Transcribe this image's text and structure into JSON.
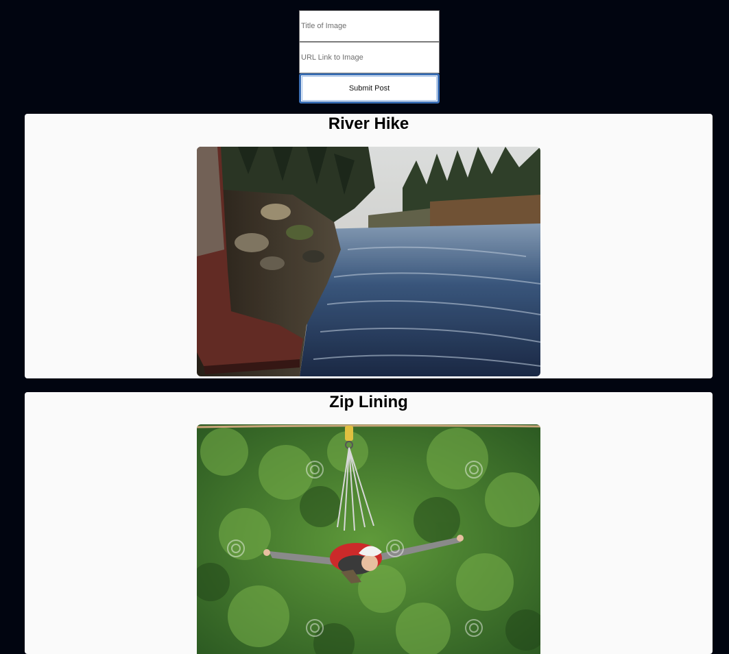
{
  "form": {
    "title_placeholder": "Title of Image",
    "url_placeholder": "URL Link to Image",
    "submit_label": "Submit Post"
  },
  "posts": [
    {
      "title": "River Hike",
      "image": "river-hike-photo"
    },
    {
      "title": "Zip Lining",
      "image": "zip-lining-photo"
    }
  ],
  "colors": {
    "page_background": "#010510",
    "card_background": "#fafafa",
    "submit_border": "#3b6fb5"
  }
}
